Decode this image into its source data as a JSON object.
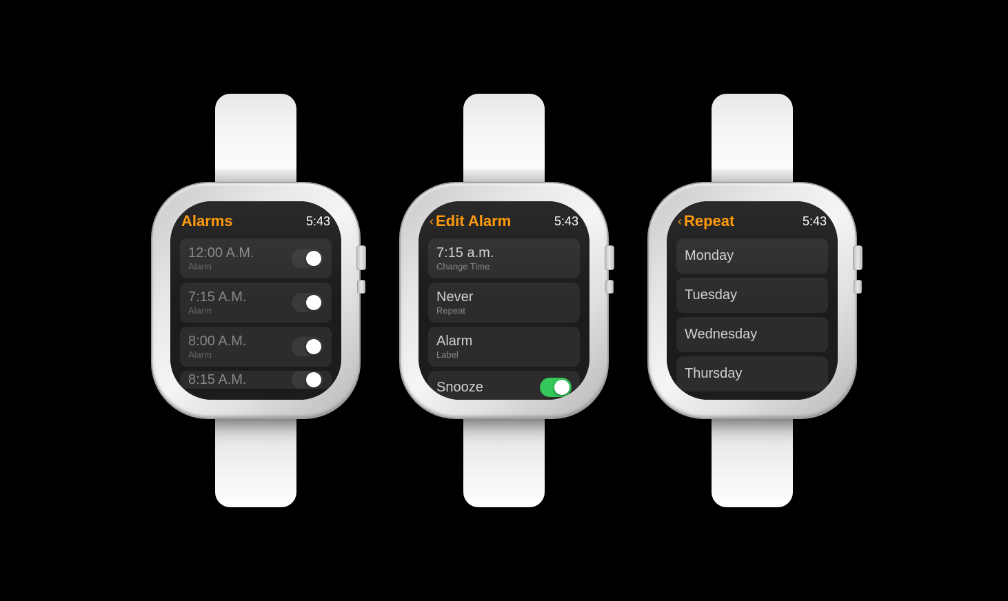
{
  "watch1": {
    "title": "Alarms",
    "time": "5:43",
    "alarms": [
      {
        "time": "12:00 A.M.",
        "label": "Alarm",
        "toggle": false
      },
      {
        "time": "7:15 A.M.",
        "label": "Alarm",
        "toggle": false
      },
      {
        "time": "8:00 A.M.",
        "label": "Alarm",
        "toggle": false
      },
      {
        "time": "8:15 A.M.",
        "label": "",
        "toggle": false
      }
    ]
  },
  "watch2": {
    "title": "Edit Alarm",
    "time": "5:43",
    "back_label": "<",
    "items": [
      {
        "main": "7:15 a.m.",
        "sub": "Change Time"
      },
      {
        "main": "Never",
        "sub": "Repeat"
      },
      {
        "main": "Alarm",
        "sub": "Label"
      },
      {
        "main": "Snooze",
        "sub": "",
        "toggle": true
      }
    ]
  },
  "watch3": {
    "title": "Repeat",
    "time": "5:43",
    "back_label": "<",
    "days": [
      "Monday",
      "Tuesday",
      "Wednesday",
      "Thursday"
    ]
  }
}
